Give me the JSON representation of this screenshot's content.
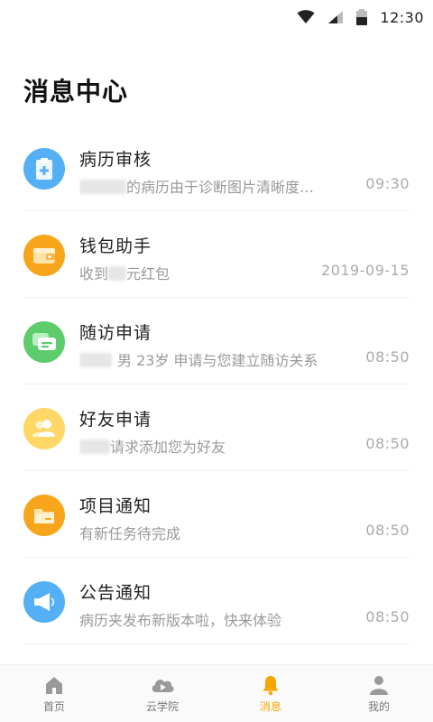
{
  "status_bar": {
    "time": "12:30"
  },
  "page_title": "消息中心",
  "messages": [
    {
      "icon": "medical-record-icon",
      "color": "#55aff5",
      "title": "病历审核",
      "preview": "的病历由于诊断图片清晰度…",
      "time": "09:30"
    },
    {
      "icon": "wallet-icon",
      "color": "#f7a51a",
      "title": "钱包助手",
      "preview_prefix": "收到",
      "preview": "元红包",
      "time": "2019-09-15"
    },
    {
      "icon": "chat-icon",
      "color": "#5ccc6c",
      "title": "随访申请",
      "preview": "男 23岁 申请与您建立随访关系",
      "time": "08:50"
    },
    {
      "icon": "friends-icon",
      "color": "#ffd766",
      "title": "好友申请",
      "preview": "请求添加您为好友",
      "time": "08:50"
    },
    {
      "icon": "folder-icon",
      "color": "#f7a51a",
      "title": "项目通知",
      "preview": "有新任务待完成",
      "time": "08:50"
    },
    {
      "icon": "megaphone-icon",
      "color": "#55aff5",
      "title": "公告通知",
      "preview": "病历夹发布新版本啦，快来体验",
      "time": "08:50"
    }
  ],
  "tabs": [
    {
      "label": "首页",
      "icon": "home-icon",
      "active": false
    },
    {
      "label": "云学院",
      "icon": "cloud-play-icon",
      "active": false
    },
    {
      "label": "消息",
      "icon": "bell-icon",
      "active": true
    },
    {
      "label": "我的",
      "icon": "user-icon",
      "active": false
    }
  ],
  "colors": {
    "accent": "#f7a600",
    "tab_inactive": "#9a9a9a"
  }
}
